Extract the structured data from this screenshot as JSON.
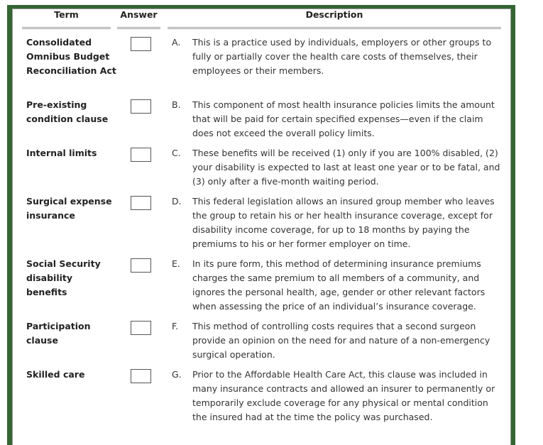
{
  "headers": {
    "term": "Term",
    "answer": "Answer",
    "description": "Description"
  },
  "colors": {
    "frame": "#336633"
  },
  "rows": [
    {
      "term": "Consolidated Omnibus Budget Reconciliation Act",
      "answer": "",
      "letter": "A.",
      "description": "This is a practice used by individuals, employers or other groups to fully or partially cover the health care costs of themselves, their employees or their members."
    },
    {
      "term": "Pre-existing condition clause",
      "answer": "",
      "letter": "B.",
      "description": "This component of most health insurance policies limits the amount that will be paid for certain specified expenses—even if the claim does not exceed the overall policy limits."
    },
    {
      "term": "Internal limits",
      "answer": "",
      "letter": "C.",
      "description": "These benefits will be received (1) only if you are 100% disabled, (2) your disability is expected to last at least one year or to be fatal, and (3) only after a five-month waiting period."
    },
    {
      "term": "Surgical expense insurance",
      "answer": "",
      "letter": "D.",
      "description": "This federal legislation allows an insured group member who leaves the group to retain his or her health insurance coverage, except for disability income coverage, for up to 18 months by paying the premiums to his or her former employer on time."
    },
    {
      "term": "Social Security disability benefits",
      "answer": "",
      "letter": "E.",
      "description": "In its pure form, this method of determining insurance premiums charges the same premium to all members of a community, and ignores the personal health, age, gender or other relevant factors when assessing the price of an individual’s insurance coverage."
    },
    {
      "term": "Participation clause",
      "answer": "",
      "letter": "F.",
      "description": "This method of controlling costs requires that a second surgeon provide an opinion on the need for and nature of a non-emergency surgical operation."
    },
    {
      "term": "Skilled care",
      "answer": "",
      "letter": "G.",
      "description": "Prior to the Affordable Health Care Act, this clause was included in many insurance contracts and allowed an insurer to permanently or temporarily exclude coverage for any physical or mental condition the insured had at the time the policy was purchased."
    }
  ]
}
